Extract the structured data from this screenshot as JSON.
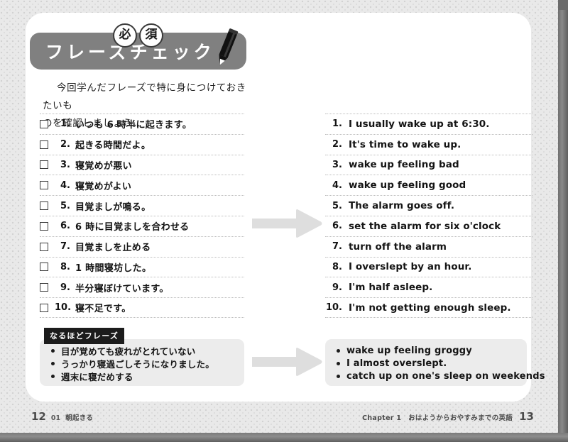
{
  "header": {
    "badge_1": "必",
    "badge_2": "須",
    "title": "フレーズチェック",
    "pencil_icon": "pencil-icon"
  },
  "intro": {
    "line_1": "今回学んだフレーズで特に身につけておきたいも",
    "line_2": "のを確認しましょう。"
  },
  "checklist": {
    "japanese": [
      {
        "num": "1.",
        "text": "いつも 6 時半に起きます。"
      },
      {
        "num": "2.",
        "text": "起きる時間だよ。"
      },
      {
        "num": "3.",
        "text": "寝覚めが悪い"
      },
      {
        "num": "4.",
        "text": "寝覚めがよい"
      },
      {
        "num": "5.",
        "text": "目覚ましが鳴る。"
      },
      {
        "num": "6.",
        "text": "6 時に目覚ましを合わせる"
      },
      {
        "num": "7.",
        "text": "目覚ましを止める"
      },
      {
        "num": "8.",
        "text": "1 時間寝坊した。"
      },
      {
        "num": "9.",
        "text": "半分寝ぼけています。"
      },
      {
        "num": "10.",
        "text": "寝不足です。"
      }
    ],
    "english": [
      {
        "num": "1.",
        "text": "I usually wake up at 6:30."
      },
      {
        "num": "2.",
        "text": "It's time to wake up."
      },
      {
        "num": "3.",
        "text": "wake up feeling bad"
      },
      {
        "num": "4.",
        "text": "wake up feeling good"
      },
      {
        "num": "5.",
        "text": "The alarm goes off."
      },
      {
        "num": "6.",
        "text": "set the alarm for six o'clock"
      },
      {
        "num": "7.",
        "text": "turn off the alarm"
      },
      {
        "num": "8.",
        "text": "I overslept by an hour."
      },
      {
        "num": "9.",
        "text": "I'm half asleep."
      },
      {
        "num": "10.",
        "text": "I'm not getting enough sleep."
      }
    ]
  },
  "extra_section": {
    "label": "なるほどフレーズ",
    "japanese": [
      "目が覚めても疲れがとれていない",
      "うっかり寝過ごしそうになりました。",
      "週末に寝だめする"
    ],
    "english": [
      "wake up feeling groggy",
      "I almost overslept.",
      "catch up on one's sleep on weekends"
    ]
  },
  "arrows": {
    "arrow_1": "arrow-right-icon",
    "arrow_2": "arrow-right-icon"
  },
  "footer": {
    "left_page": "12",
    "left_section_num": "01",
    "left_section_title": "朝起きる",
    "right_chapter": "Chapter 1　おはようからおやすみまでの英語",
    "right_page": "13"
  },
  "colors": {
    "banner": "#808080",
    "arrow": "#dedede",
    "box": "#ececec",
    "label": "#1c1c1c"
  }
}
